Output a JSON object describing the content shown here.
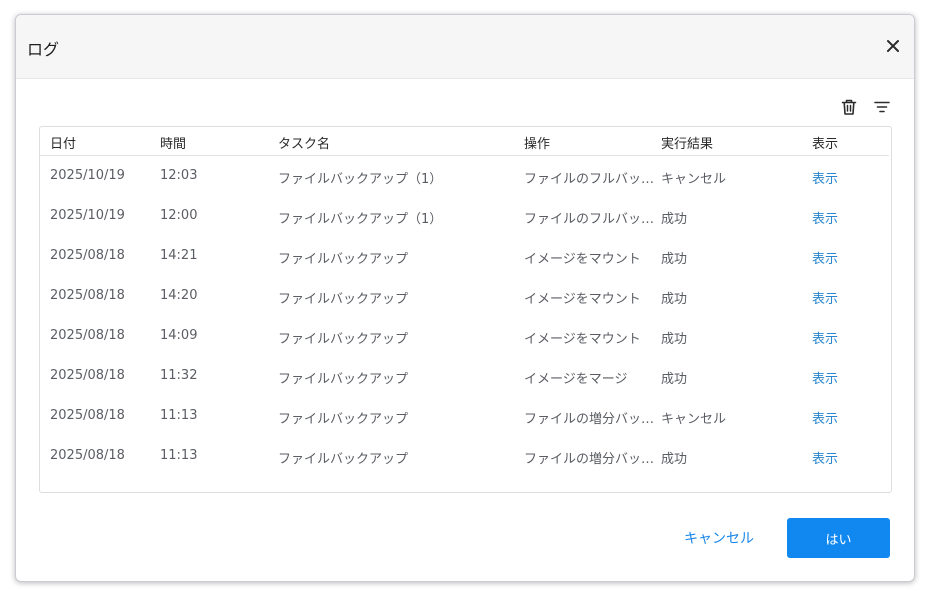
{
  "dialog": {
    "title": "ログ",
    "close_icon": "close-icon"
  },
  "toolbar": {
    "trash_icon": "trash-icon",
    "filter_icon": "filter-icon"
  },
  "table": {
    "headers": {
      "date": "日付",
      "time": "時間",
      "task": "タスク名",
      "operation": "操作",
      "result": "実行結果",
      "view": "表示"
    },
    "rows": [
      {
        "date": "2025/10/19",
        "time": "12:03",
        "task": "ファイルバックアップ（1）",
        "operation": "ファイルのフルバックアップ",
        "result": "キャンセル",
        "view": "表示"
      },
      {
        "date": "2025/10/19",
        "time": "12:00",
        "task": "ファイルバックアップ（1）",
        "operation": "ファイルのフルバックアップ",
        "result": "成功",
        "view": "表示"
      },
      {
        "date": "2025/08/18",
        "time": "14:21",
        "task": "ファイルバックアップ",
        "operation": "イメージをマウント",
        "result": "成功",
        "view": "表示"
      },
      {
        "date": "2025/08/18",
        "time": "14:20",
        "task": "ファイルバックアップ",
        "operation": "イメージをマウント",
        "result": "成功",
        "view": "表示"
      },
      {
        "date": "2025/08/18",
        "time": "14:09",
        "task": "ファイルバックアップ",
        "operation": "イメージをマウント",
        "result": "成功",
        "view": "表示"
      },
      {
        "date": "2025/08/18",
        "time": "11:32",
        "task": "ファイルバックアップ",
        "operation": "イメージをマージ",
        "result": "成功",
        "view": "表示"
      },
      {
        "date": "2025/08/18",
        "time": "11:13",
        "task": "ファイルバックアップ",
        "operation": "ファイルの増分バックア...",
        "result": "キャンセル",
        "view": "表示"
      },
      {
        "date": "2025/08/18",
        "time": "11:13",
        "task": "ファイルバックアップ",
        "operation": "ファイルの増分バックア...",
        "result": "成功",
        "view": "表示"
      }
    ]
  },
  "footer": {
    "cancel_label": "キャンセル",
    "yes_label": "はい"
  },
  "colors": {
    "accent": "#1088f0",
    "link": "#2a86cf"
  }
}
